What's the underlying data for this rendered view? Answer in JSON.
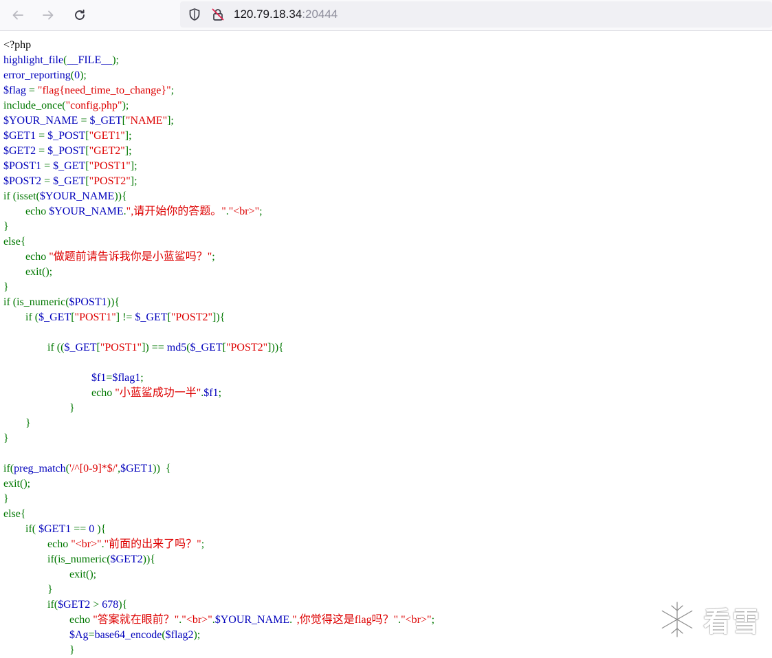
{
  "browser": {
    "url_host": "120.79.18.34",
    "url_port": ":20444",
    "icons": [
      "back-arrow-icon",
      "forward-arrow-icon",
      "reload-icon",
      "shield-icon",
      "insecure-lock-icon"
    ]
  },
  "colors": {
    "keyword": "#007700",
    "default": "#0000BB",
    "string": "#DD0000",
    "html": "#000000"
  },
  "code_lines": [
    [
      [
        "h",
        "<?php"
      ]
    ],
    [
      [
        "d",
        "highlight_file"
      ],
      [
        "k",
        "("
      ],
      [
        "d",
        "__FILE__"
      ],
      [
        "k",
        ");"
      ]
    ],
    [
      [
        "d",
        "error_reporting"
      ],
      [
        "k",
        "("
      ],
      [
        "d",
        "0"
      ],
      [
        "k",
        ");"
      ]
    ],
    [
      [
        "d",
        "$flag "
      ],
      [
        "k",
        "= "
      ],
      [
        "s",
        "\"flag{need_time_to_change}\""
      ],
      [
        "k",
        ";"
      ]
    ],
    [
      [
        "k",
        "include_once("
      ],
      [
        "s",
        "\"config.php\""
      ],
      [
        "k",
        ");"
      ]
    ],
    [
      [
        "d",
        "$YOUR_NAME "
      ],
      [
        "k",
        "= "
      ],
      [
        "d",
        "$_GET"
      ],
      [
        "k",
        "["
      ],
      [
        "s",
        "\"NAME\""
      ],
      [
        "k",
        "];"
      ]
    ],
    [
      [
        "d",
        "$GET1 "
      ],
      [
        "k",
        "= "
      ],
      [
        "d",
        "$_POST"
      ],
      [
        "k",
        "["
      ],
      [
        "s",
        "\"GET1\""
      ],
      [
        "k",
        "];"
      ]
    ],
    [
      [
        "d",
        "$GET2 "
      ],
      [
        "k",
        "= "
      ],
      [
        "d",
        "$_POST"
      ],
      [
        "k",
        "["
      ],
      [
        "s",
        "\"GET2\""
      ],
      [
        "k",
        "];"
      ]
    ],
    [
      [
        "d",
        "$POST1 "
      ],
      [
        "k",
        "= "
      ],
      [
        "d",
        "$_GET"
      ],
      [
        "k",
        "["
      ],
      [
        "s",
        "\"POST1\""
      ],
      [
        "k",
        "];"
      ]
    ],
    [
      [
        "d",
        "$POST2 "
      ],
      [
        "k",
        "= "
      ],
      [
        "d",
        "$_GET"
      ],
      [
        "k",
        "["
      ],
      [
        "s",
        "\"POST2\""
      ],
      [
        "k",
        "];"
      ]
    ],
    [
      [
        "k",
        "if (isset("
      ],
      [
        "d",
        "$YOUR_NAME"
      ],
      [
        "k",
        ")){"
      ]
    ],
    [
      [
        "k",
        "        echo "
      ],
      [
        "d",
        "$YOUR_NAME"
      ],
      [
        "k",
        "."
      ],
      [
        "s",
        "\",请开始你的答题。\""
      ],
      [
        "k",
        "."
      ],
      [
        "s",
        "\"<br>\""
      ],
      [
        "k",
        ";"
      ]
    ],
    [
      [
        "k",
        "}"
      ]
    ],
    [
      [
        "k",
        "else{"
      ]
    ],
    [
      [
        "k",
        "        echo "
      ],
      [
        "s",
        "\"做题前请告诉我你是小蓝鲨吗？\""
      ],
      [
        "k",
        ";"
      ]
    ],
    [
      [
        "k",
        "        exit();"
      ]
    ],
    [
      [
        "k",
        "}"
      ]
    ],
    [
      [
        "k",
        "if (is_numeric("
      ],
      [
        "d",
        "$POST1"
      ],
      [
        "k",
        "))"
      ],
      [
        "k",
        "{"
      ]
    ],
    [
      [
        "k",
        "        if ("
      ],
      [
        "d",
        "$_GET"
      ],
      [
        "k",
        "["
      ],
      [
        "s",
        "\"POST1\""
      ],
      [
        "k",
        "] != "
      ],
      [
        "d",
        "$_GET"
      ],
      [
        "k",
        "["
      ],
      [
        "s",
        "\"POST2\""
      ],
      [
        "k",
        "]){"
      ]
    ],
    [],
    [
      [
        "k",
        "                if (("
      ],
      [
        "d",
        "$_GET"
      ],
      [
        "k",
        "["
      ],
      [
        "s",
        "\"POST1\""
      ],
      [
        "k",
        "]) == "
      ],
      [
        "d",
        "md5"
      ],
      [
        "k",
        "("
      ],
      [
        "d",
        "$_GET"
      ],
      [
        "k",
        "["
      ],
      [
        "s",
        "\"POST2\""
      ],
      [
        "k",
        "])){"
      ]
    ],
    [],
    [
      [
        "d",
        "                                $f1"
      ],
      [
        "k",
        "="
      ],
      [
        "d",
        "$flag1"
      ],
      [
        "k",
        ";"
      ]
    ],
    [
      [
        "k",
        "                                echo "
      ],
      [
        "s",
        "\"小蓝鲨成功一半\""
      ],
      [
        "k",
        "."
      ],
      [
        "d",
        "$f1"
      ],
      [
        "k",
        ";"
      ]
    ],
    [
      [
        "k",
        "                        }"
      ]
    ],
    [
      [
        "k",
        "        }"
      ]
    ],
    [
      [
        "k",
        "}"
      ]
    ],
    [],
    [
      [
        "k",
        "if("
      ],
      [
        "d",
        "preg_match"
      ],
      [
        "k",
        "("
      ],
      [
        "s",
        "'/^[0-9]*$/'"
      ],
      [
        "k",
        ","
      ],
      [
        "d",
        "$GET1"
      ],
      [
        "k",
        "))  {"
      ]
    ],
    [
      [
        "k",
        "exit();"
      ]
    ],
    [
      [
        "k",
        "}"
      ]
    ],
    [
      [
        "k",
        "else{"
      ]
    ],
    [
      [
        "k",
        "        if( "
      ],
      [
        "d",
        "$GET1 "
      ],
      [
        "k",
        "== "
      ],
      [
        "d",
        "0 "
      ],
      [
        "k",
        "){"
      ]
    ],
    [
      [
        "k",
        "                echo "
      ],
      [
        "s",
        "\"<br>\""
      ],
      [
        "k",
        "."
      ],
      [
        "s",
        "\"前面的出来了吗？\""
      ],
      [
        "k",
        ";"
      ]
    ],
    [
      [
        "k",
        "                if(is_numeric("
      ],
      [
        "d",
        "$GET2"
      ],
      [
        "k",
        "))"
      ],
      [
        "k",
        "{"
      ]
    ],
    [
      [
        "k",
        "                        exit();"
      ]
    ],
    [
      [
        "k",
        "                }"
      ]
    ],
    [
      [
        "k",
        "                if("
      ],
      [
        "d",
        "$GET2 "
      ],
      [
        "k",
        "> "
      ],
      [
        "d",
        "678"
      ],
      [
        "k",
        "){"
      ]
    ],
    [
      [
        "k",
        "                        echo "
      ],
      [
        "s",
        "\"答案就在眼前？\""
      ],
      [
        "k",
        "."
      ],
      [
        "s",
        "\"<br>\""
      ],
      [
        "k",
        "."
      ],
      [
        "d",
        "$YOUR_NAME"
      ],
      [
        "k",
        "."
      ],
      [
        "s",
        "\",你觉得这是flag吗？\""
      ],
      [
        "k",
        "."
      ],
      [
        "s",
        "\"<br>\""
      ],
      [
        "k",
        ";"
      ]
    ],
    [
      [
        "d",
        "                        $Ag"
      ],
      [
        "k",
        "="
      ],
      [
        "d",
        "base64_encode"
      ],
      [
        "k",
        "("
      ],
      [
        "d",
        "$flag2"
      ],
      [
        "k",
        ");"
      ]
    ],
    [
      [
        "k",
        "                        }"
      ]
    ]
  ],
  "watermark": {
    "text": "看雪",
    "icon": "snowflake-icon"
  }
}
